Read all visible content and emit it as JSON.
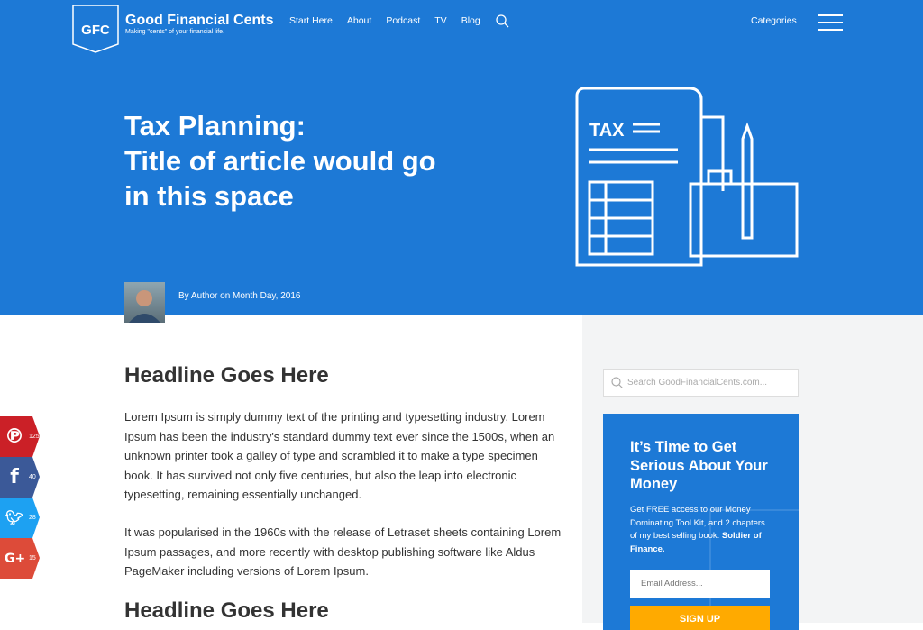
{
  "header": {
    "logo_text": "GFC",
    "brand": "Good Financial Cents",
    "tagline": "Making \"cents\" of your financial life.",
    "nav": [
      "Start Here",
      "About",
      "Podcast",
      "TV",
      "Blog"
    ],
    "categories": "Categories"
  },
  "hero": {
    "title_line1": "Tax Planning:",
    "title_line2": "Title of article would go",
    "title_line3": "in this space",
    "illustration_text": "TAX",
    "byline": "By Author on Month Day, 2016"
  },
  "article": {
    "headline1": "Headline Goes Here",
    "para1": "Lorem Ipsum is simply dummy text of the printing and typesetting industry. Lorem Ipsum has been the industry's standard dummy text ever since the 1500s, when an unknown printer took a galley of type and scrambled it to make a type specimen book. It has survived not only five centuries, but also the leap into electronic typesetting, remaining essentially unchanged.",
    "para2": "It was popularised in the 1960s with the release of Letraset sheets containing Lorem Ipsum passages, and more recently with desktop publishing software like Aldus PageMaker including versions of Lorem Ipsum.",
    "headline2": "Headline Goes Here"
  },
  "sidebar": {
    "search_placeholder": "Search GoodFinancialCents.com...",
    "promo_title": "It’s Time to Get Serious About Your Money",
    "promo_body": "Get FREE access to our Money Dominating Tool Kit, and 2 chapters of my best selling book: ",
    "promo_book": "Soldier of Finance.",
    "email_placeholder": "Email Address...",
    "signup": "SIGN UP"
  },
  "social": [
    {
      "network": "pinterest",
      "count": "125",
      "color": "#cb2027"
    },
    {
      "network": "facebook",
      "count": "40",
      "color": "#3b5998"
    },
    {
      "network": "twitter",
      "count": "28",
      "color": "#1da1f2"
    },
    {
      "network": "google-plus",
      "count": "15",
      "color": "#dd4b39"
    }
  ],
  "colors": {
    "brand_blue": "#1d79d6",
    "signup": "#ffaa00"
  }
}
